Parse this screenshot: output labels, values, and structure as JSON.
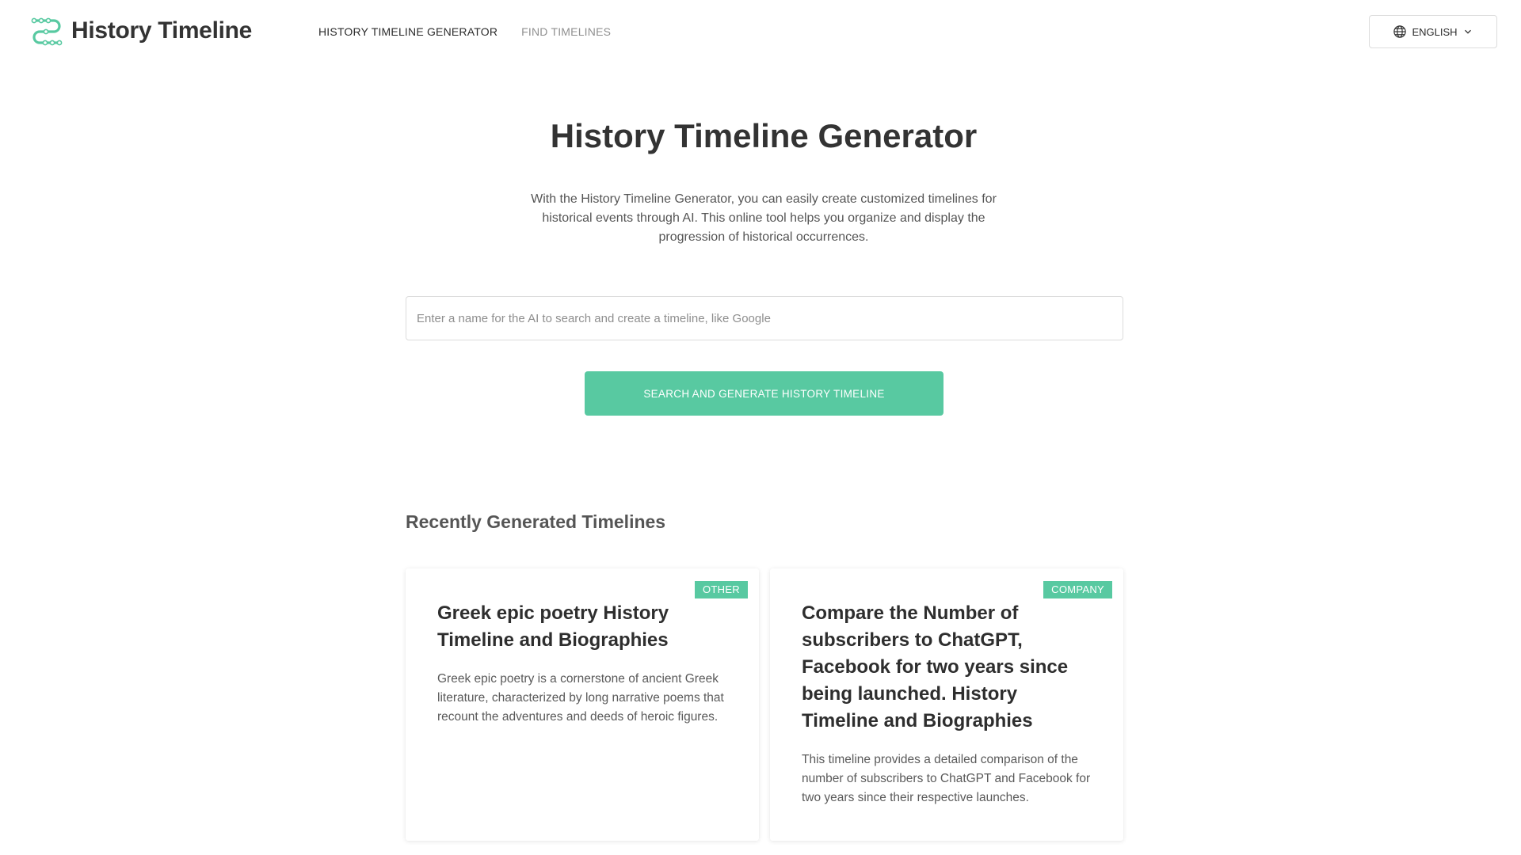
{
  "header": {
    "logo_text": "History Timeline",
    "nav": [
      {
        "label": "HISTORY TIMELINE GENERATOR"
      },
      {
        "label": "FIND TIMELINES"
      }
    ],
    "language_label": "ENGLISH"
  },
  "hero": {
    "title": "History Timeline Generator",
    "description": "With the History Timeline Generator, you can easily create customized timelines for historical events through AI. This online tool helps you organize and display the progression of historical occurrences.",
    "search_placeholder": "Enter a name for the AI to search and create a timeline, like Google",
    "search_value": "",
    "button_label": "SEARCH AND GENERATE HISTORY TIMELINE"
  },
  "recent": {
    "title": "Recently Generated Timelines",
    "cards": [
      {
        "badge": "OTHER",
        "title": "Greek epic poetry History Timeline and Biographies",
        "description": "Greek epic poetry is a cornerstone of ancient Greek literature, characterized by long narrative poems that recount the adventures and deeds of heroic figures."
      },
      {
        "badge": "COMPANY",
        "title": "Compare the Number of subscribers to ChatGPT, Facebook for two years since being launched. History Timeline and Biographies",
        "description": "This timeline provides a detailed comparison of the number of subscribers to ChatGPT and Facebook for two years since their respective launches."
      }
    ]
  },
  "colors": {
    "accent": "#58c9a1",
    "text_dark": "#333333",
    "text_muted": "#8f8f8f"
  },
  "icons": {
    "logo": "timeline-logo-icon",
    "language": "globe-icon",
    "dropdown": "chevron-down-icon"
  }
}
